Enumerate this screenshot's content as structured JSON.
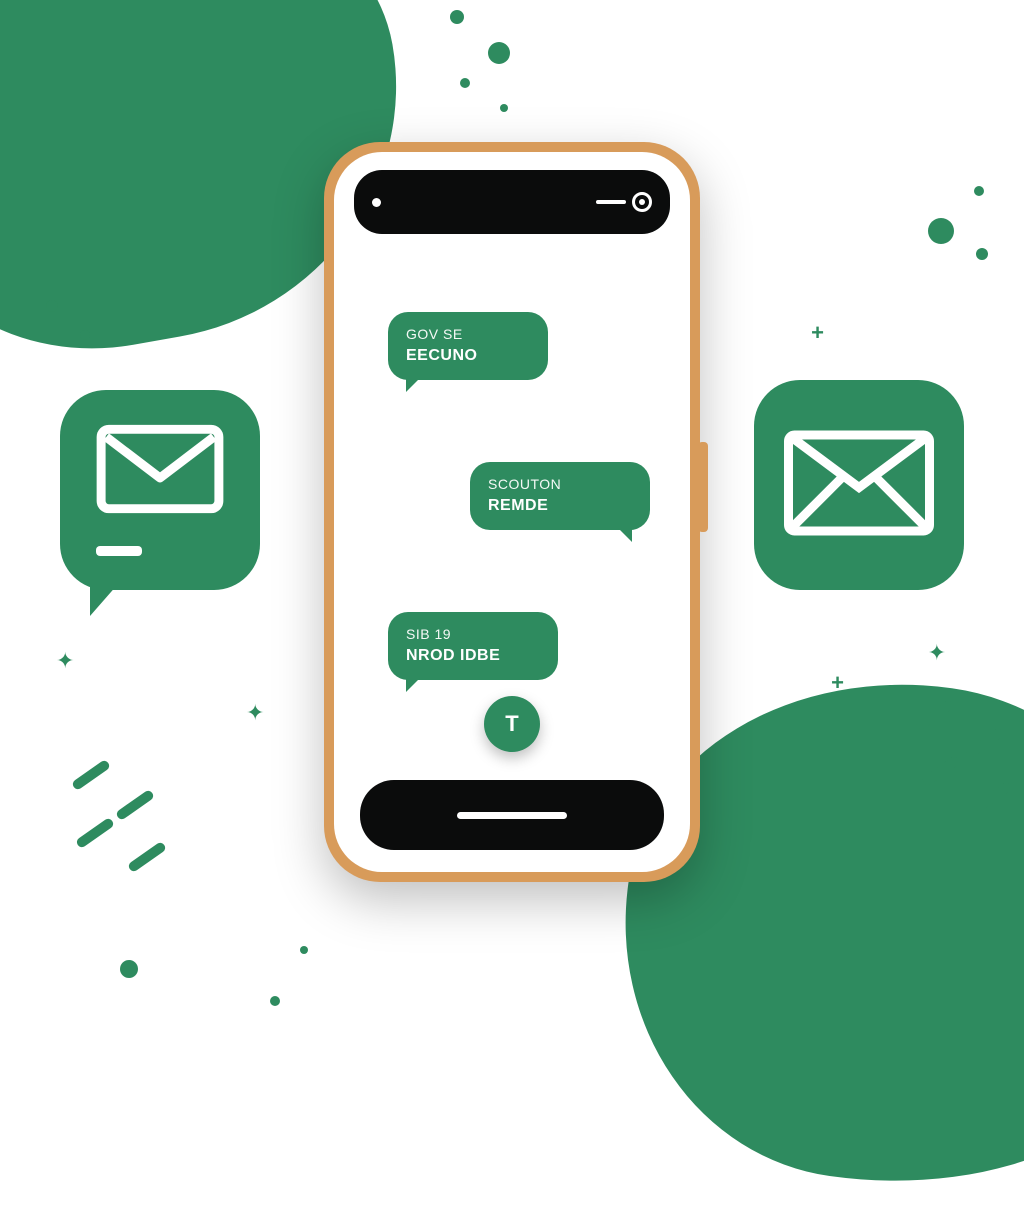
{
  "colors": {
    "accent": "#2e8b5f",
    "phoneFrame": "#d89b5a",
    "dark": "#0b0c0c"
  },
  "chat": {
    "messages": [
      {
        "line1": "GOV SE",
        "line2": "EECUNO"
      },
      {
        "line1": "SCOUTON",
        "line2": "REMDE"
      },
      {
        "line1": "SIB 19",
        "line2": "NROD IDBE"
      }
    ],
    "compose_label": "T"
  },
  "icons": {
    "left": "mail-icon",
    "right": "mail-icon"
  }
}
